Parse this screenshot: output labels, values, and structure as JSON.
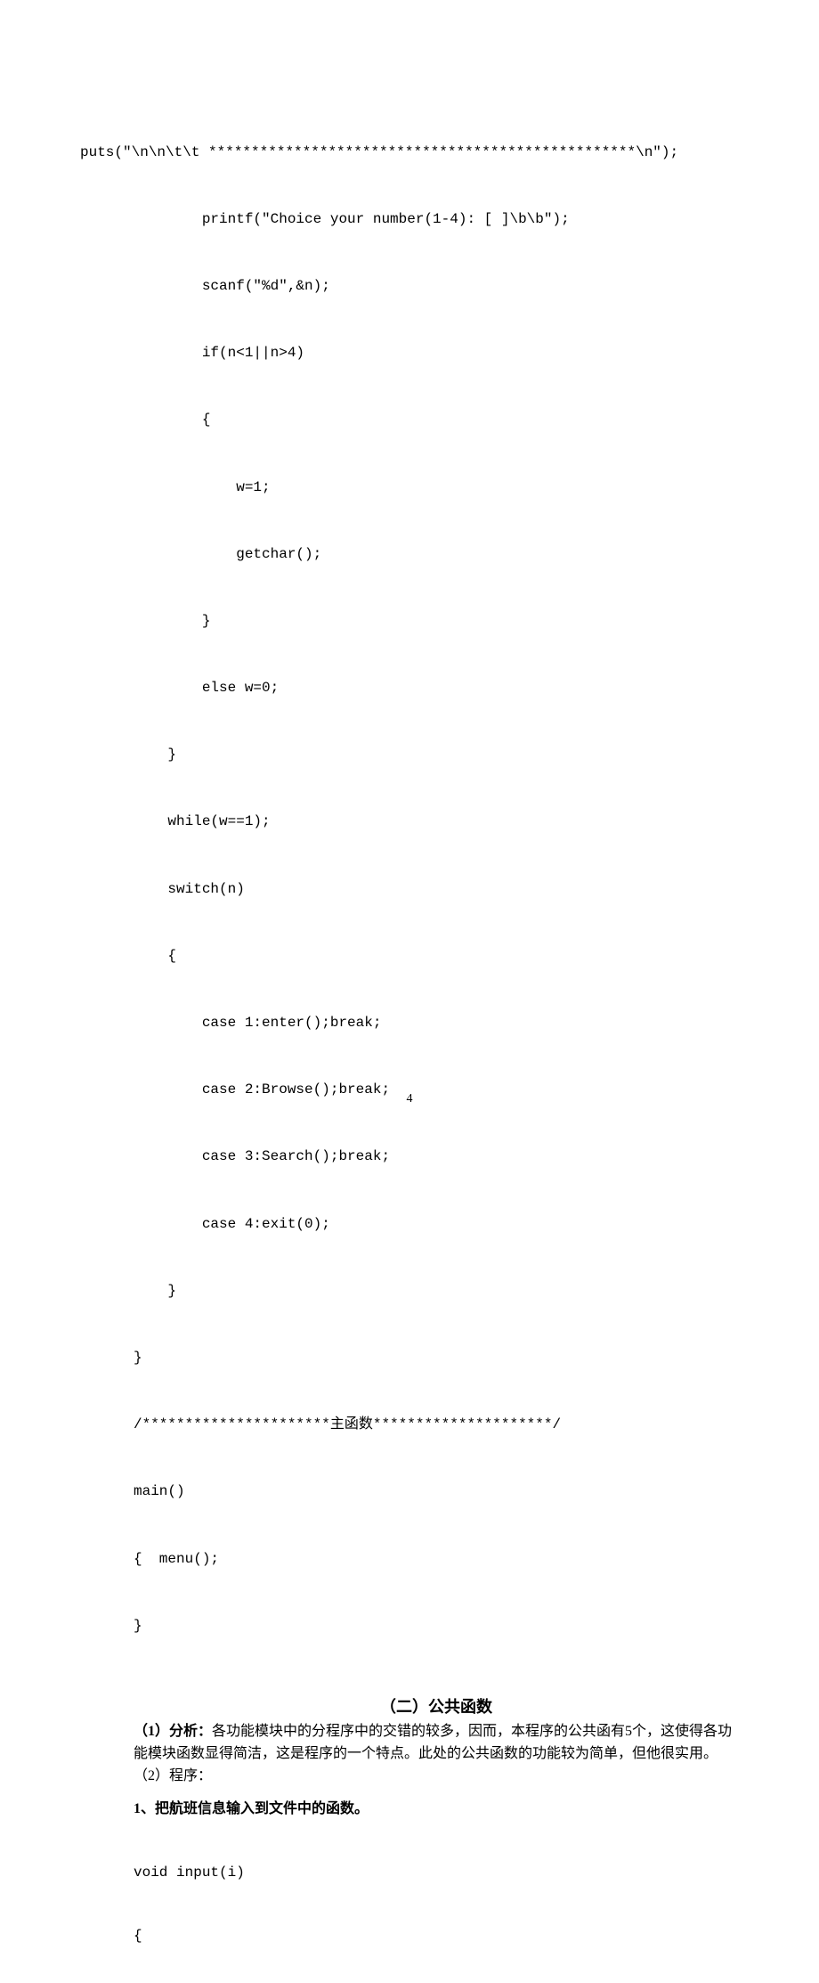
{
  "code1": {
    "l1": "puts(\"\\n\\n\\t\\t **************************************************\\n\");",
    "l2": "        printf(\"Choice your number(1-4): [ ]\\b\\b\");",
    "l3": "        scanf(\"%d\",&n);",
    "l4": "        if(n<1||n>4)",
    "l5": "        {",
    "l6": "            w=1;",
    "l7": "            getchar();",
    "l8": "        }",
    "l9": "        else w=0;",
    "l10": "    }",
    "l11": "    while(w==1);",
    "l12": "    switch(n)",
    "l13": "    {",
    "l14": "        case 1:enter();break;",
    "l15": "        case 2:Browse();break;",
    "l16": "        case 3:Search();break;",
    "l17": "        case 4:exit(0);",
    "l18": "    }",
    "l19": "}",
    "l20": "/**********************主函数*********************/",
    "l21": "main()",
    "l22": "{  menu();",
    "l23": "}"
  },
  "section": {
    "heading": "（二）公共函数",
    "p1_label": "（1）分析：",
    "p1_text": "各功能模块中的分程序中的交错的较多，因而，本程序的公共函有5个，这使得各功能模块函数显得简洁，这是程序的一个特点。此处的公共函数的功能较为简单，但他很实用。",
    "p2_label": "（2）程序：",
    "sub1": "1、把航班信息输入到文件中的函数。"
  },
  "code2": {
    "l1": "void input(i)",
    "l2": "{"
  },
  "pagenum": "4"
}
